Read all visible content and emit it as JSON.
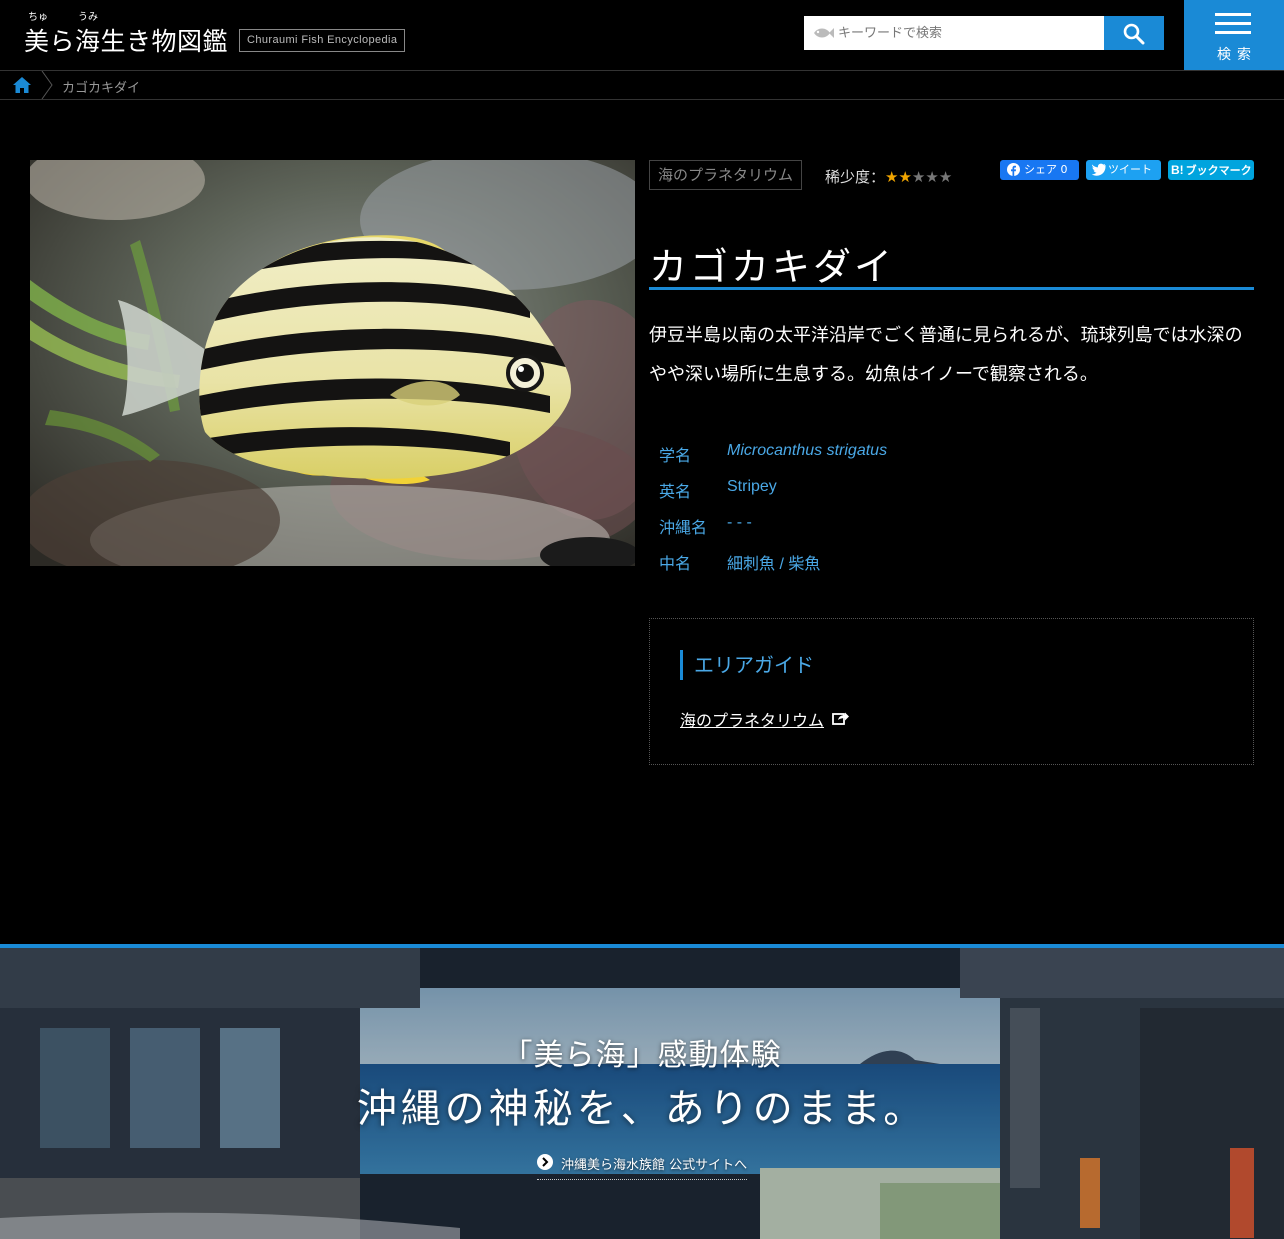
{
  "header": {
    "logo_ruby_1": "ちゅ",
    "logo_ruby_2": "うみ",
    "logo_title": "美ら海生き物図鑑",
    "logo_subtitle": "Churaumi Fish Encyclopedia",
    "search_placeholder": "キーワードで検索",
    "menu_label": "検索",
    "accent_color": "#1a8ad6"
  },
  "breadcrumb": {
    "home_icon": "home-icon",
    "current": "カゴカキダイ"
  },
  "fish": {
    "area_tag": "海のプラネタリウム",
    "rarity_label": "稀少度：",
    "rarity_value": 2,
    "rarity_max": 5,
    "name": "カゴカキダイ",
    "description": "伊豆半島以南の太平洋沿岸でごく普通に見られるが、琉球列島では水深のやや深い場所に生息する。幼魚はイノーで観察される。",
    "info": [
      {
        "label": "学名",
        "value": "Microcanthus strigatus"
      },
      {
        "label": "英名",
        "value": "Stripey"
      },
      {
        "label": "沖縄名",
        "value": "- - -"
      },
      {
        "label": "中名",
        "value": "細刺魚 / 柴魚"
      }
    ]
  },
  "share": {
    "facebook": "シェア 0",
    "twitter": "ツイート",
    "hatena": "ブックマーク"
  },
  "area_guide": {
    "title": "エリアガイド",
    "link": "海のプラネタリウム"
  },
  "banner": {
    "subtitle": "「美ら海」感動体験",
    "title": "沖縄の神秘を、ありのまま。",
    "link": "沖縄美ら海水族館 公式サイトへ"
  }
}
